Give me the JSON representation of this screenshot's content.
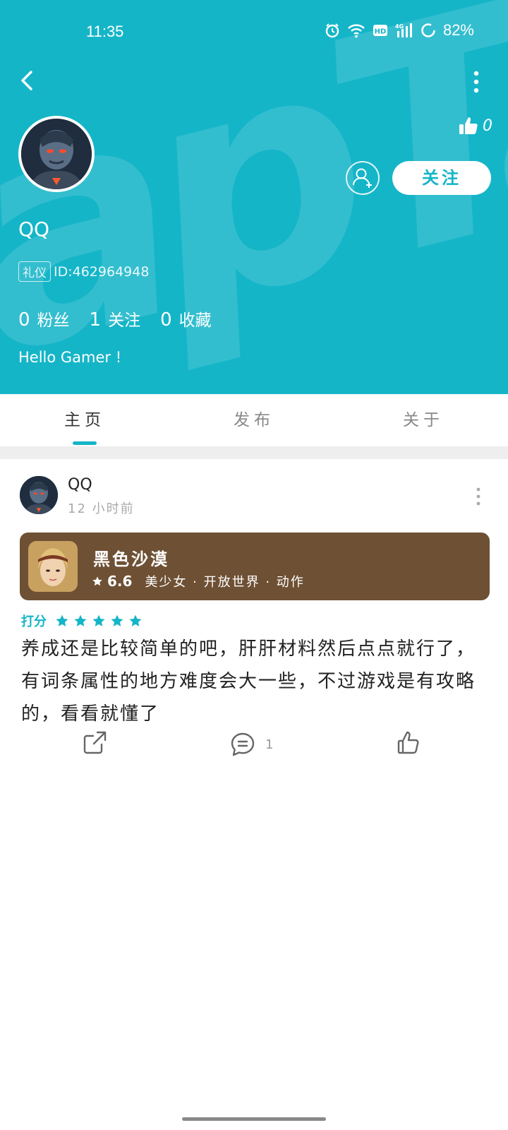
{
  "status_bar": {
    "time": "11:35",
    "battery": "82%"
  },
  "header": {
    "watermark": "apTap",
    "like_count": "0",
    "follow_label": "关注",
    "username": "QQ",
    "badge": "礼仪",
    "user_id": "ID:462964948",
    "stats": [
      {
        "num": "0",
        "label": "粉丝"
      },
      {
        "num": "1",
        "label": "关注"
      },
      {
        "num": "0",
        "label": "收藏"
      }
    ],
    "bio": "Hello Gamer !",
    "accent_color": "#15b5c8"
  },
  "tabs": [
    {
      "label": "主页",
      "active": true
    },
    {
      "label": "发布",
      "active": false
    },
    {
      "label": "关于",
      "active": false
    }
  ],
  "post": {
    "author": "QQ",
    "time": "12 小时前",
    "game": {
      "title": "黑色沙漠",
      "score": "6.6",
      "tags": "美少女 · 开放世界 · 动作",
      "card_color": "#6e5034"
    },
    "rating_label": "打分",
    "rating_stars": 5,
    "text": "养成还是比较简单的吧，肝肝材料然后点点就行了，有词条属性的地方难度会大一些，不过游戏是有攻略的，看看就懂了",
    "comment_count": "1"
  }
}
